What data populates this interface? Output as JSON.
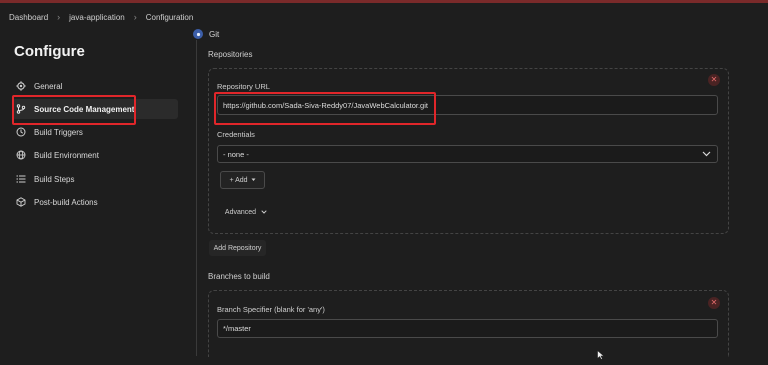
{
  "breadcrumb": [
    "Dashboard",
    "java-application",
    "Configuration"
  ],
  "sidebar": {
    "title": "Configure",
    "items": [
      {
        "label": "General",
        "icon": "gear-icon"
      },
      {
        "label": "Source Code Management",
        "icon": "branch-icon",
        "active": true
      },
      {
        "label": "Build Triggers",
        "icon": "clock-icon"
      },
      {
        "label": "Build Environment",
        "icon": "globe-icon"
      },
      {
        "label": "Build Steps",
        "icon": "list-icon"
      },
      {
        "label": "Post-build Actions",
        "icon": "cube-icon"
      }
    ]
  },
  "scm": {
    "option": "Git",
    "repositories_title": "Repositories",
    "repository_url_label": "Repository URL",
    "repository_url_value": "https://github.com/Sada-Siva-Reddy07/JavaWebCalculator.git",
    "credentials_label": "Credentials",
    "credentials_value": "- none -",
    "add_label": "+ Add",
    "advanced_label": "Advanced",
    "add_repository_label": "Add Repository",
    "branches_title": "Branches to build",
    "branch_specifier_label": "Branch Specifier (blank for 'any')",
    "branch_specifier_value": "*/master"
  },
  "colors": {
    "background": "#1e1e1e",
    "highlight": "#e0262a",
    "git_option": "#3c5ea8",
    "delete": "#e46c6c"
  }
}
